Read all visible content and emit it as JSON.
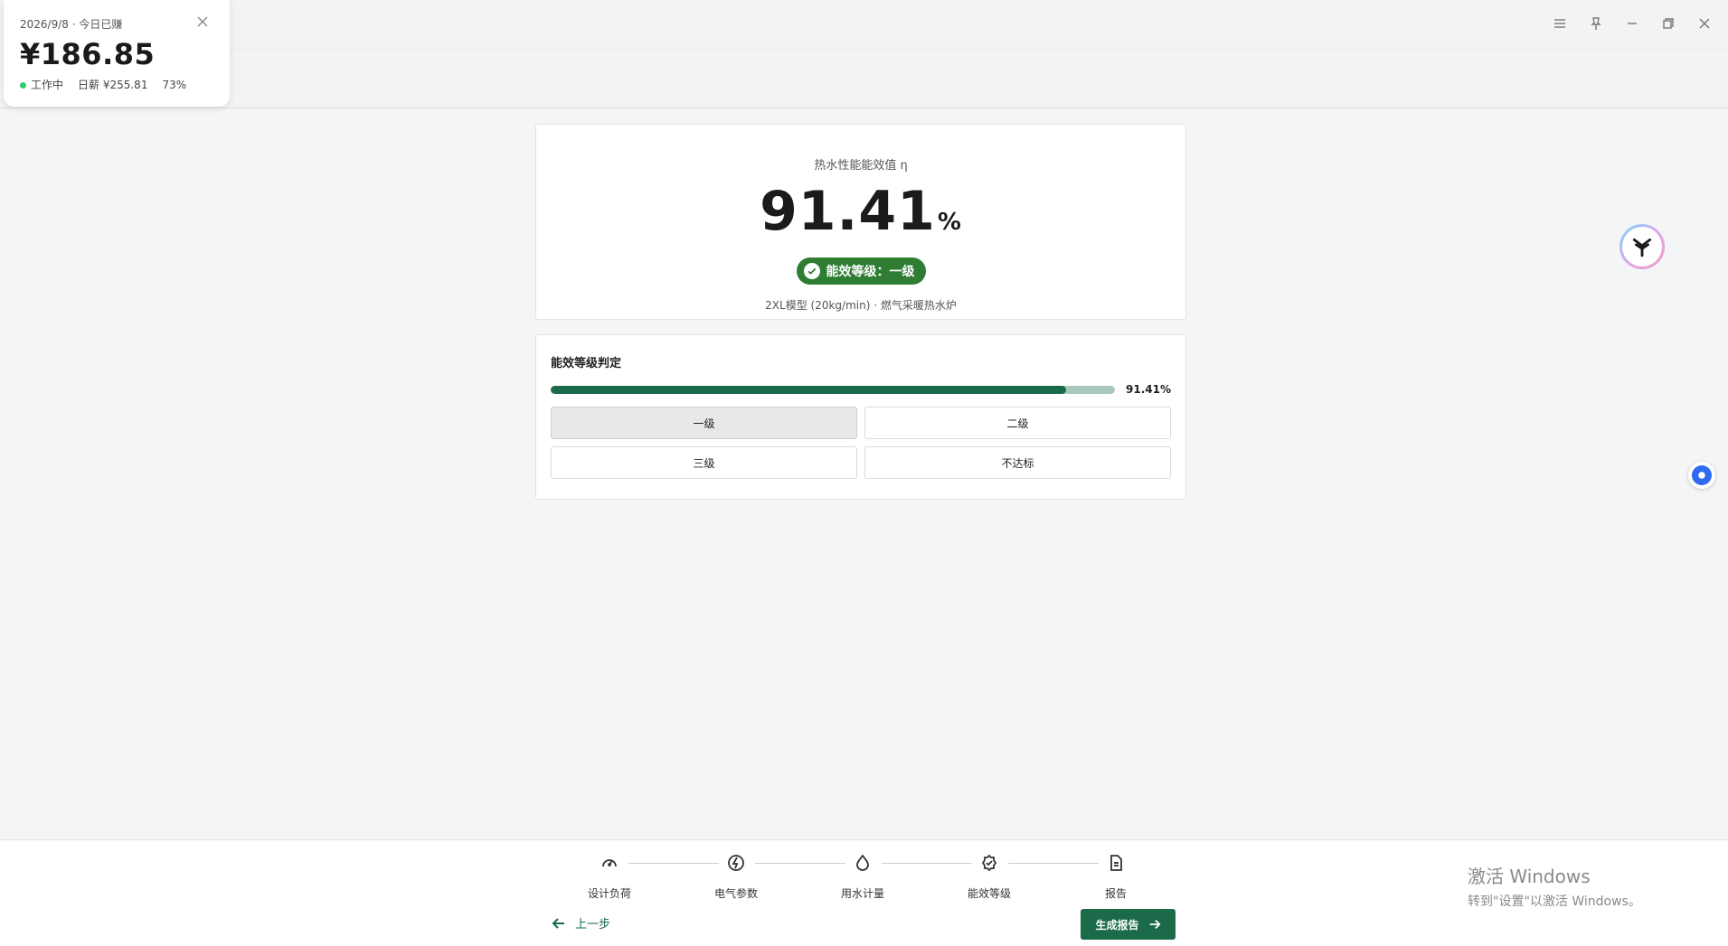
{
  "widget": {
    "date": "2026/9/8 · 今日已赚",
    "amount": "¥186.85",
    "status": "工作中",
    "daily": "日薪 ¥255.81",
    "percent": "73%"
  },
  "result": {
    "label": "热水性能能效值 η",
    "value": "91.41",
    "unit": "%",
    "badge": "能效等级：一级",
    "desc": "2XL模型 (20kg/min) · 燃气采暖热水炉"
  },
  "grading": {
    "title": "能效等级判定",
    "progress": 0.9141,
    "progress_label": "91.41%",
    "grades": [
      "一级",
      "二级",
      "三级",
      "不达标"
    ],
    "active_grade": "一级"
  },
  "steps": [
    {
      "label": "设计负荷",
      "icon": "gauge-icon"
    },
    {
      "label": "电气参数",
      "icon": "lightning-icon"
    },
    {
      "label": "用水计量",
      "icon": "water-drop-icon"
    },
    {
      "label": "能效等级",
      "icon": "badge-check-icon"
    },
    {
      "label": "报告",
      "icon": "document-icon"
    }
  ],
  "footer": {
    "prev_label": "上一步",
    "generate_label": "生成报告"
  },
  "watermark": {
    "line1": "激活 Windows",
    "line2": "转到\"设置\"以激活 Windows。"
  },
  "colors": {
    "primary": "#1b6b4a",
    "badge": "#2e7d32",
    "track": "#a9c9bd"
  }
}
